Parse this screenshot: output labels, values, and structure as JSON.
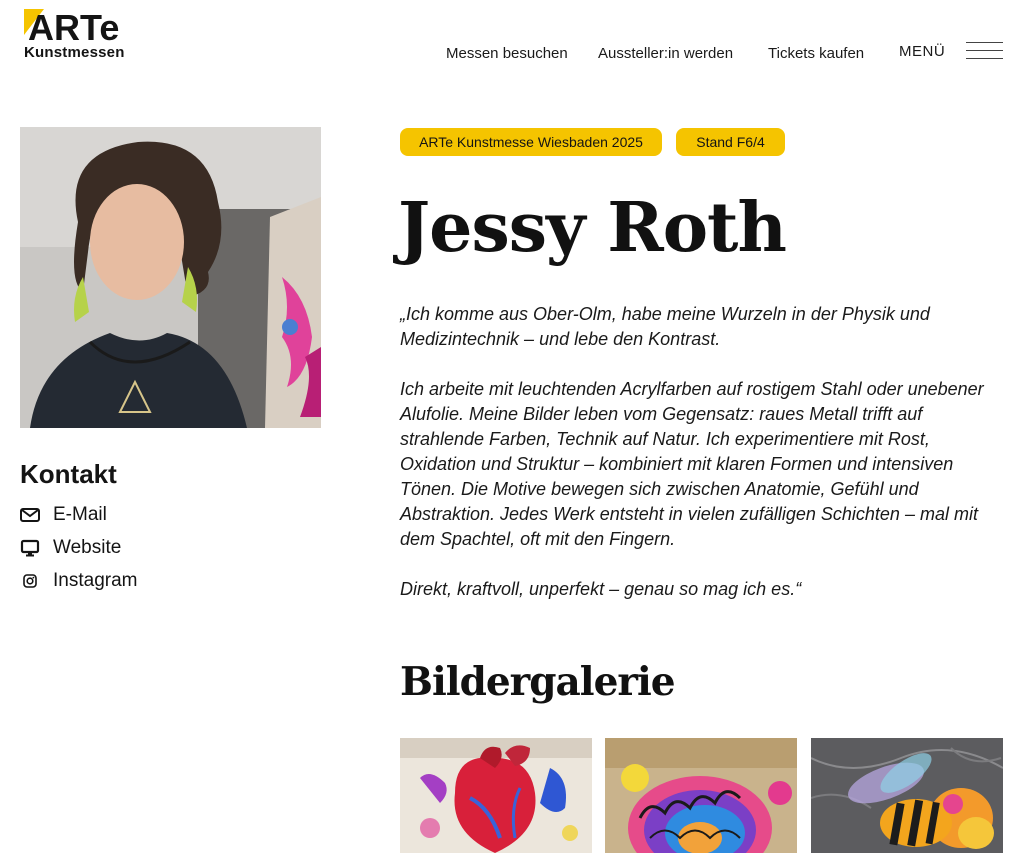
{
  "header": {
    "logo_text": "ARTe",
    "logo_subtitle": "Kunstmessen",
    "nav": [
      "Messen besuchen",
      "Aussteller:in werden",
      "Tickets kaufen"
    ],
    "menu_label": "MENÜ"
  },
  "badges": [
    "ARTe Kunstmesse Wiesbaden 2025",
    "Stand F6/4"
  ],
  "artist": {
    "name": "Jessy Roth",
    "quote": [
      "„Ich komme aus Ober-Olm, habe meine Wurzeln in der Physik und Medizintechnik – und lebe den Kontrast.",
      "Ich arbeite mit leuchtenden Acrylfarben auf rostigem Stahl oder unebener Alufolie. Meine Bilder leben vom Gegensatz: raues Metall trifft auf strahlende Farben, Technik auf Natur. Ich experimentiere mit Rost, Oxidation und Struktur – kombiniert mit klaren Formen und intensiven Tönen. Die Motive bewegen sich zwischen Anatomie, Gefühl und Abstraktion. Jedes Werk entsteht in vielen zufälligen Schichten – mal mit dem Spachtel, oft mit den Fingern.",
      "Direkt, kraftvoll, unperfekt – genau so mag ich es.“"
    ]
  },
  "contact": {
    "title": "Kontakt",
    "items": [
      {
        "label": "E-Mail",
        "icon": "envelope-icon"
      },
      {
        "label": "Website",
        "icon": "monitor-icon"
      },
      {
        "label": "Instagram",
        "icon": "instagram-icon"
      }
    ]
  },
  "gallery": {
    "title": "Bildergalerie",
    "items": [
      {
        "subject": "heart",
        "icon": "heart-painting"
      },
      {
        "subject": "brain",
        "icon": "brain-painting"
      },
      {
        "subject": "bee",
        "icon": "bee-painting"
      }
    ]
  },
  "colors": {
    "accent_yellow": "#f5c400",
    "text": "#141414",
    "background": "#ffffff"
  }
}
